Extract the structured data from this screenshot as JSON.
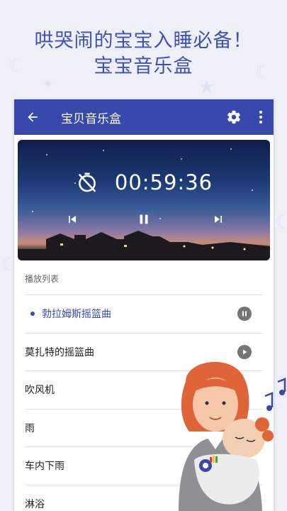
{
  "promo": {
    "headline_line1": "哄哭闹的宝宝入睡必备！",
    "headline_line2": "宝宝音乐盒"
  },
  "appbar": {
    "title": "宝贝音乐盒",
    "back_icon": "arrow-left-icon",
    "settings_icon": "gear-icon",
    "more_icon": "more-vertical-icon",
    "color": "#3949ab"
  },
  "player": {
    "timer_icon": "timer-off-icon",
    "time": "00:59:36",
    "prev_icon": "skip-previous-icon",
    "pause_icon": "pause-icon",
    "next_icon": "skip-next-icon"
  },
  "playlist": {
    "label": "播放列表",
    "items": [
      {
        "title": "勃拉姆斯摇篮曲",
        "state": "playing",
        "control_icon": "pause-circle-icon"
      },
      {
        "title": "莫扎特的摇篮曲",
        "state": "idle",
        "control_icon": "play-circle-icon"
      },
      {
        "title": "吹风机",
        "state": "idle"
      },
      {
        "title": "雨",
        "state": "idle"
      },
      {
        "title": "车内下雨",
        "state": "idle"
      },
      {
        "title": "淋浴",
        "state": "idle"
      }
    ]
  },
  "colors": {
    "accent": "#3949ab",
    "background": "#eef0f8",
    "control_gray": "#757575"
  }
}
